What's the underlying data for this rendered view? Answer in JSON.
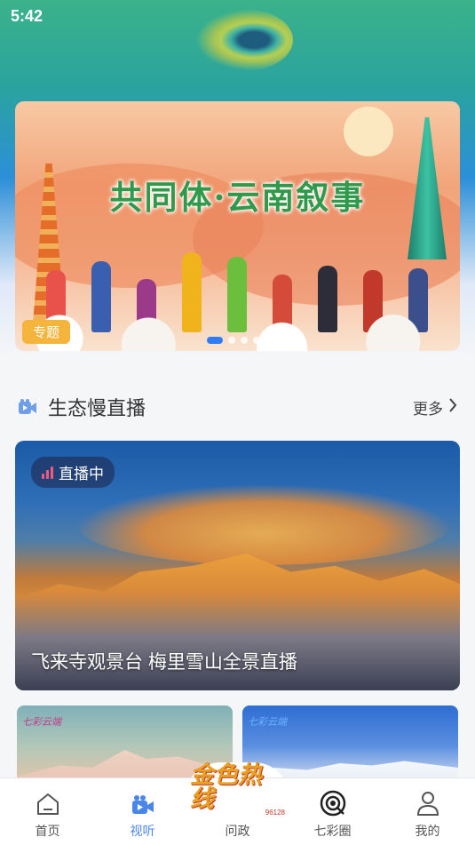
{
  "status_bar": {
    "time": "5:42"
  },
  "banner": {
    "title": "共同体·云南叙事",
    "tag": "专题",
    "dots": 4,
    "active_dot": 0
  },
  "section": {
    "title": "生态慢直播",
    "more_label": "更多",
    "icon": "video-camera-icon"
  },
  "live_card": {
    "badge_label": "直播中",
    "title": "飞来寺观景台 梅里雪山全景直播"
  },
  "thumbnails": [
    {
      "logo_text": "七彩云端"
    },
    {
      "logo_text": "七彩云端"
    }
  ],
  "tabbar": {
    "items": [
      {
        "label": "首页",
        "icon": "home-icon",
        "active": false
      },
      {
        "label": "视听",
        "icon": "video-camera-icon",
        "active": true
      },
      {
        "label": "问政",
        "icon": "hotline-logo",
        "active": false,
        "logo_text": "金色热线",
        "logo_sub": "96128"
      },
      {
        "label": "七彩圈",
        "icon": "camera-lens-icon",
        "active": false
      },
      {
        "label": "我的",
        "icon": "user-icon",
        "active": false
      }
    ]
  },
  "colors": {
    "accent": "#4a86e8",
    "tag": "#f5b43b",
    "banner_title": "#2f9a4b",
    "live_bars": "#f05a7e"
  }
}
